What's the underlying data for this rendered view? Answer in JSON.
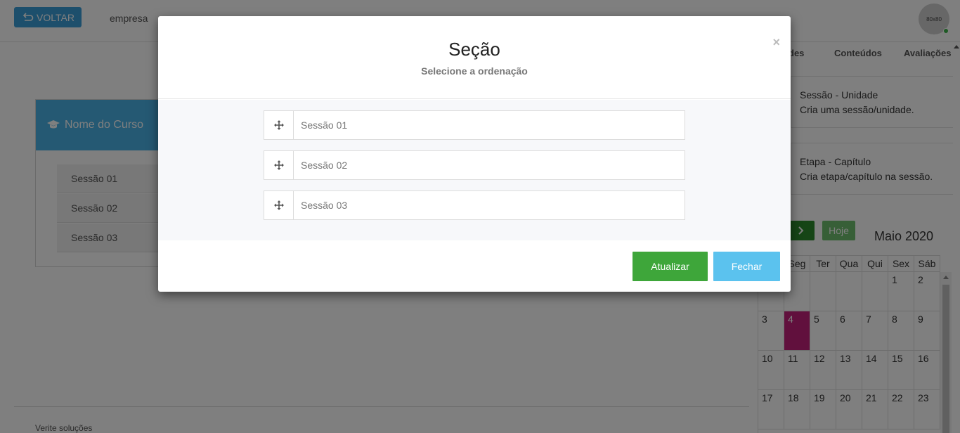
{
  "header": {
    "back_label": "VOLTAR",
    "company": "empresa",
    "avatar_text": "80x80"
  },
  "tabs": [
    {
      "label": "des"
    },
    {
      "label": "Conteúdos"
    },
    {
      "label": "Avaliações"
    }
  ],
  "actions": [
    {
      "title": "Sessão - Unidade",
      "description": "Cria uma sessão/unidade."
    },
    {
      "title": "Etapa - Capítulo",
      "description": "Cria etapa/capítulo na sessão."
    }
  ],
  "course": {
    "title": "Nome do Curso",
    "sessions": [
      "Sessão 01",
      "Sessão 02",
      "Sessão 03"
    ]
  },
  "calendar": {
    "today_label": "Hoje",
    "month_title": "Maio 2020",
    "weekdays": [
      "Seg",
      "Ter",
      "Qua",
      "Qui",
      "Sex",
      "Sáb"
    ],
    "today_day": "4",
    "accent_color": "#c2217a"
  },
  "footer": {
    "text": "Verite soluções"
  },
  "modal": {
    "title": "Seção",
    "subtitle": "Selecione a ordenação",
    "close_symbol": "×",
    "items": [
      "Sessão 01",
      "Sessão 02",
      "Sessão 03"
    ],
    "update_label": "Atualizar",
    "close_label": "Fechar"
  }
}
